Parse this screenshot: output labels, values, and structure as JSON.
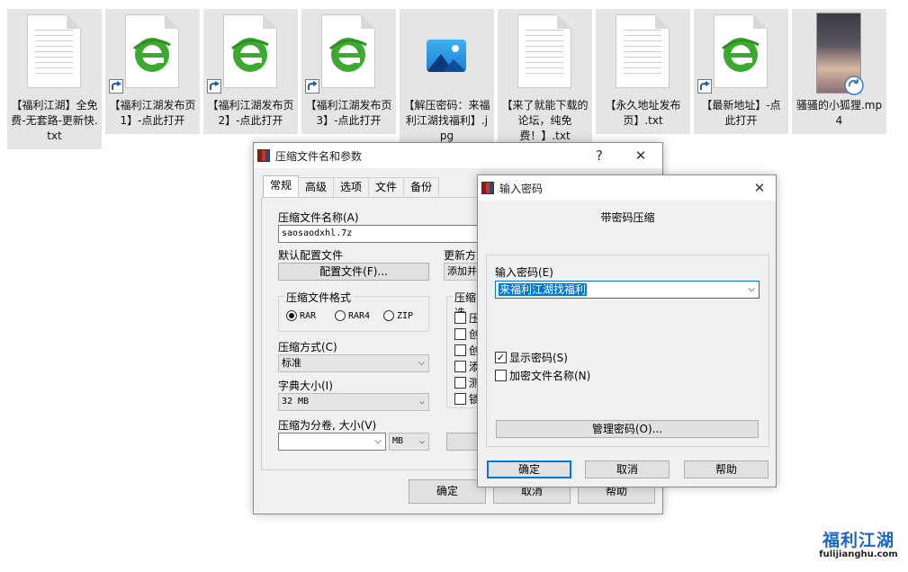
{
  "files": [
    {
      "name": "【福利江湖】全免费-无套路-更新快.txt",
      "icon": "text-file-icon",
      "shortcut": false
    },
    {
      "name": "【福利江湖发布页1】-点此打开",
      "icon": "ie-browser-icon",
      "shortcut": true
    },
    {
      "name": "【福利江湖发布页2】-点此打开",
      "icon": "ie-browser-icon",
      "shortcut": true
    },
    {
      "name": "【福利江湖发布页3】-点此打开",
      "icon": "ie-browser-icon",
      "shortcut": true
    },
    {
      "name": "【解压密码：来福利江湖找福利】.jpg",
      "icon": "image-file-icon",
      "shortcut": false
    },
    {
      "name": "【来了就能下载的论坛，纯免费！】.txt",
      "icon": "text-file-icon",
      "shortcut": false
    },
    {
      "name": "【永久地址发布页】.txt",
      "icon": "text-file-icon",
      "shortcut": false
    },
    {
      "name": "【最新地址】-点此打开",
      "icon": "ie-browser-icon",
      "shortcut": true
    },
    {
      "name": "骚骚的小狐狸.mp4",
      "icon": "video-thumbnail",
      "shortcut": false
    }
  ],
  "archive_dialog": {
    "title": "压缩文件名和参数",
    "help": "?",
    "close": "✕",
    "tabs": [
      "常规",
      "高级",
      "选项",
      "文件",
      "备份"
    ],
    "archive_name_label": "压缩文件名称(A)",
    "archive_name_value": "saosaodxhl.7z",
    "profile_label": "默认配置文件",
    "profile_button": "配置文件(F)...",
    "update_label": "更新方式",
    "update_value": "添加并",
    "format_group": "压缩文件格式",
    "formats": [
      "RAR",
      "RAR4",
      "ZIP"
    ],
    "method_label": "压缩方式(C)",
    "method_value": "标准",
    "dict_label": "字典大小(I)",
    "dict_value": "32 MB",
    "split_label": "压缩为分卷, 大小(V)",
    "split_unit": "MB",
    "options_group": "压缩选",
    "options": [
      "压",
      "创",
      "创",
      "添",
      "测",
      "锁"
    ],
    "ok": "确定",
    "cancel": "取消",
    "help_button": "帮助"
  },
  "password_dialog": {
    "title": "输入密码",
    "close": "✕",
    "heading": "带密码压缩",
    "password_label": "输入密码(E)",
    "password_value": "来福利江湖找福利",
    "show_password": "显示密码(S)",
    "show_password_checked": true,
    "encrypt_names": "加密文件名称(N)",
    "encrypt_names_checked": false,
    "manage_button": "管理密码(O)...",
    "ok": "确定",
    "cancel": "取消",
    "help": "帮助"
  },
  "watermark": {
    "main": "福利江湖",
    "sub": "fulijianghu.com"
  },
  "colors": {
    "selection": "#0078d7",
    "ie_green": "#3caa2e",
    "tile_bg": "#e5e5e5"
  }
}
